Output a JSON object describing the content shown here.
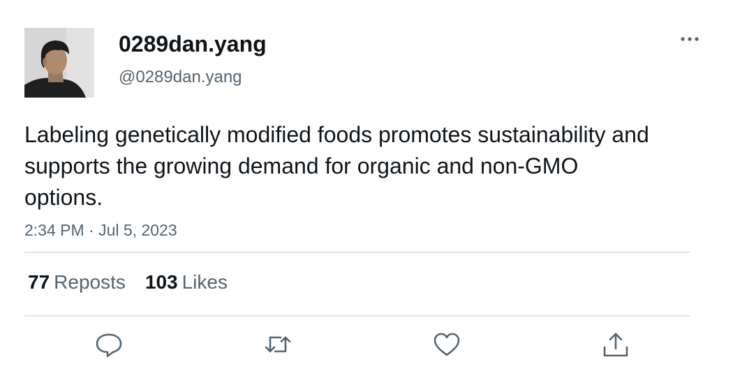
{
  "author": {
    "display_name": "0289dan.yang",
    "handle": "@0289dan.yang",
    "avatar_icon": "profile-photo"
  },
  "header": {
    "more_icon": "more-horizontal-icon"
  },
  "tweet": {
    "text": "Labeling genetically modified foods promotes sustainability and supports the growing demand for organic and non-GMO options.",
    "timestamp": "2:34 PM · Jul 5, 2023"
  },
  "stats": {
    "reposts_count": "77",
    "reposts_label": "Reposts",
    "likes_count": "103",
    "likes_label": "Likes"
  },
  "actions": [
    {
      "icon": "reply-icon"
    },
    {
      "icon": "repost-icon"
    },
    {
      "icon": "like-icon"
    },
    {
      "icon": "share-icon"
    }
  ],
  "colors": {
    "primary_text": "#0f1419",
    "secondary_text": "#536471",
    "divider": "#e4e8ea",
    "icon": "#536471"
  }
}
